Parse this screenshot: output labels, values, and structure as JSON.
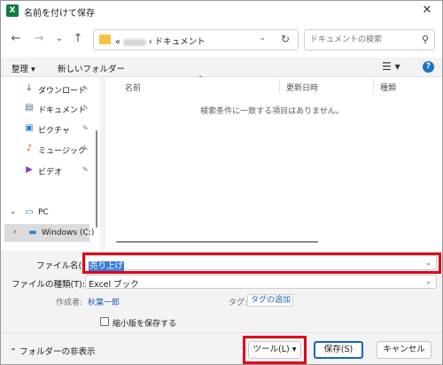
{
  "window": {
    "title": "名前を付けて保存",
    "app_icon": "X"
  },
  "nav": {
    "back": "←",
    "forward": "→",
    "recent": "⌄",
    "up": "↑",
    "address": {
      "prefix": "«",
      "current": "ドキュメント",
      "separator": "›"
    },
    "search_placeholder": "ドキュメントの検索"
  },
  "commands": {
    "organize": "整理 ▾",
    "new_folder": "新しいフォルダー"
  },
  "navpane": {
    "items": [
      {
        "label": "ダウンロード",
        "icon": "download-icon",
        "glyph": "↓",
        "color": "#1a7f3c"
      },
      {
        "label": "ドキュメント",
        "icon": "document-icon",
        "glyph": "▤",
        "color": "#4a6fa5"
      },
      {
        "label": "ピクチャ",
        "icon": "pictures-icon",
        "glyph": "▣",
        "color": "#2a86d8"
      },
      {
        "label": "ミュージック",
        "icon": "music-icon",
        "glyph": "♪",
        "color": "#d64a2a"
      },
      {
        "label": "ビデオ",
        "icon": "video-icon",
        "glyph": "▶",
        "color": "#8a3fc4"
      },
      {
        "label": "PC",
        "icon": "pc-icon",
        "glyph": "▭",
        "color": "#2a86d8"
      },
      {
        "label": "Windows (C:)",
        "icon": "drive-icon",
        "glyph": "▬",
        "color": "#2a86d8"
      }
    ]
  },
  "content": {
    "columns": [
      "名前",
      "更新日時",
      "種類"
    ],
    "empty_message": "検索条件に一致する項目はありません。"
  },
  "form": {
    "filename_label": "ファイル名(N):",
    "filename_value": "売り上げ",
    "filetype_label": "ファイルの種類(T):",
    "filetype_value": "Excel ブック",
    "author_label": "作成者:",
    "author_value": "秋葉一郎",
    "tag_label": "タグ:",
    "tag_value": "タグの追加",
    "thumbnail_label": "縮小版を保存する"
  },
  "bottom": {
    "toggle_folders": "フォルダーの非表示",
    "tools": "ツール(L)",
    "save": "保存(S)",
    "cancel": "キャンセル"
  },
  "colors": {
    "highlight": "#e0001a",
    "accent": "#1a63c4",
    "excel": "#107c41"
  }
}
